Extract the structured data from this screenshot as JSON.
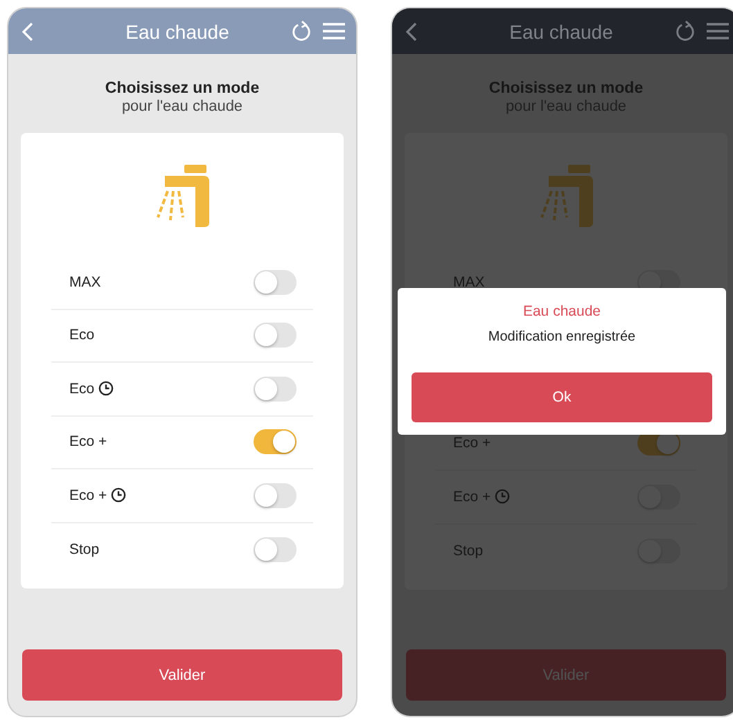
{
  "screens": [
    {
      "header": {
        "title": "Eau chaude"
      },
      "heading": "Choisissez un mode",
      "subheading": "pour l'eau chaude",
      "modes": [
        {
          "label": "MAX",
          "timer": false,
          "on": false
        },
        {
          "label": "Eco",
          "timer": false,
          "on": false
        },
        {
          "label": "Eco",
          "timer": true,
          "on": false
        },
        {
          "label": "Eco +",
          "timer": false,
          "on": true
        },
        {
          "label": "Eco +",
          "timer": true,
          "on": false
        },
        {
          "label": "Stop",
          "timer": false,
          "on": false
        }
      ],
      "button": "Valider"
    },
    {
      "header": {
        "title": "Eau chaude"
      },
      "heading": "Choisissez un mode",
      "subheading": "pour l'eau chaude",
      "modes": [
        {
          "label": "MAX",
          "timer": false,
          "on": false
        },
        {
          "label": "Eco +",
          "timer": false,
          "on": true
        },
        {
          "label": "Eco +",
          "timer": true,
          "on": false
        },
        {
          "label": "Stop",
          "timer": false,
          "on": false
        }
      ],
      "button": "Valider",
      "dialog": {
        "title": "Eau chaude",
        "message": "Modification enregistrée",
        "button": "Ok"
      }
    }
  ]
}
